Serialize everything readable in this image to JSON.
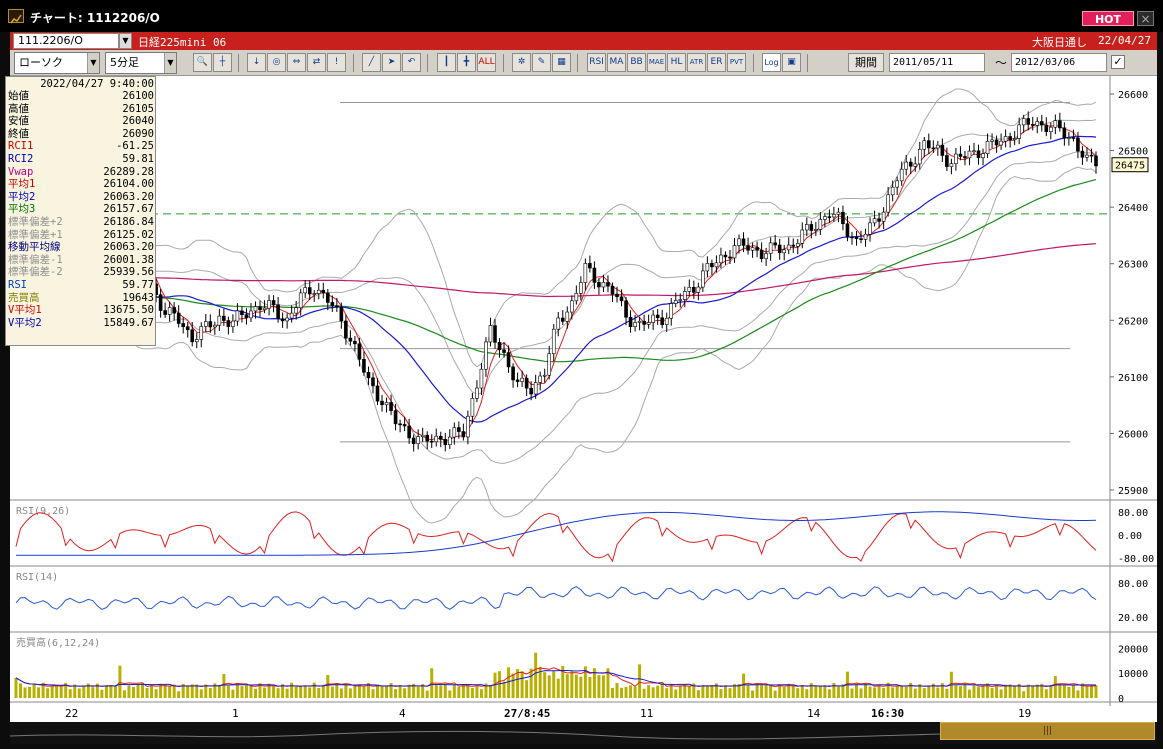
{
  "window": {
    "title": "チャート: 1112206/O",
    "hot_label": "HOT",
    "close_label": "×"
  },
  "row1": {
    "symbol_value": "111.2206/O",
    "symbol_name": "日経225mini 06",
    "feed_label": "大阪日通し",
    "feed_date": "22/04/27"
  },
  "row2": {
    "chart_type": "ローソク",
    "interval": "5分足",
    "period_label": "期間",
    "date_from": "2011/05/11",
    "date_to": "2012/03/06",
    "tilde": "〜",
    "buttons": [
      "RSI",
      "MA",
      "BB",
      "MAE",
      "HL",
      "ATR",
      "ER",
      "PVT",
      "Log"
    ]
  },
  "info": {
    "datetime": "2022/04/27  9:40:00",
    "rows": [
      {
        "label": "始値",
        "value": "26100",
        "color": "#000000"
      },
      {
        "label": "高値",
        "value": "26105",
        "color": "#000000"
      },
      {
        "label": "安値",
        "value": "26040",
        "color": "#000000"
      },
      {
        "label": "終値",
        "value": "26090",
        "color": "#000000"
      },
      {
        "label": "RCI1",
        "value": "-61.25",
        "color": "#d00000"
      },
      {
        "label": "RCI2",
        "value": "59.81",
        "color": "#0000b0"
      },
      {
        "label": "Vwap",
        "value": "26289.28",
        "color": "#c00080"
      },
      {
        "label": "平均1",
        "value": "26104.00",
        "color": "#d00000"
      },
      {
        "label": "平均2",
        "value": "26063.20",
        "color": "#0000b0"
      },
      {
        "label": "平均3",
        "value": "26157.67",
        "color": "#007000"
      },
      {
        "label": "標準偏差+2",
        "value": "26186.84",
        "color": "#909090"
      },
      {
        "label": "標準偏差+1",
        "value": "26125.02",
        "color": "#909090"
      },
      {
        "label": "移動平均線",
        "value": "26063.20",
        "color": "#000080"
      },
      {
        "label": "標準偏差-1",
        "value": "26001.38",
        "color": "#909090"
      },
      {
        "label": "標準偏差-2",
        "value": "25939.56",
        "color": "#909090"
      },
      {
        "label": "RSI",
        "value": "59.77",
        "color": "#0040c0"
      },
      {
        "label": "売買高",
        "value": "19643",
        "color": "#808000"
      },
      {
        "label": "V平均1",
        "value": "13675.50",
        "color": "#d00000"
      },
      {
        "label": "V平均2",
        "value": "15849.67",
        "color": "#0000b0"
      }
    ]
  },
  "colors": {
    "up": "#ffffff",
    "down": "#000000",
    "ma1": "#e02020",
    "ma2": "#1a1ad0",
    "ma3": "#1a8a1a",
    "vwap": "#c0186a",
    "band": "#aaaaaa",
    "dashed": "#2a9a2a",
    "rci1": "#e02020",
    "rci2": "#1a3ad0",
    "rsi": "#2a5ad8",
    "volume": "#b8b000",
    "hot": "#e3205a",
    "toolbar_red": "#c8201c"
  },
  "chart_data": [
    {
      "type": "candlestick",
      "panel": "price",
      "yticks": [
        "26600",
        "26500",
        "26400",
        "26300",
        "26200",
        "26100",
        "26000",
        "25900"
      ],
      "ylim": [
        25900,
        26600
      ],
      "current_price": "26475",
      "dashed_level": 26388,
      "hlines": [
        26585,
        26150,
        25985
      ],
      "xticks": [
        "22",
        "1",
        "4",
        "27/8:45",
        "11",
        "14",
        "16:30",
        "19"
      ],
      "series_close": [
        26230,
        26250,
        26225,
        26205,
        26180,
        26240,
        26260,
        26270,
        26230,
        26295,
        26260,
        26215,
        26200,
        26170,
        26185,
        26205,
        26195,
        26215,
        26225,
        26220,
        26200,
        26240,
        26260,
        26235,
        26200,
        26150,
        26090,
        26060,
        26020,
        26000,
        25985,
        25990,
        25995,
        26000,
        26090,
        26180,
        26140,
        26085,
        26080,
        26110,
        26200,
        26230,
        26290,
        26270,
        26250,
        26210,
        26190,
        26200,
        26210,
        26240,
        26260,
        26290,
        26310,
        26330,
        26330,
        26320,
        26325,
        26330,
        26350,
        26370,
        26390,
        26370,
        26340,
        26360,
        26400,
        26450,
        26480,
        26510,
        26500,
        26480,
        26490,
        26500,
        26510,
        26520,
        26540,
        26550,
        26545,
        26535,
        26520,
        26480
      ]
    },
    {
      "type": "line",
      "panel": "RSI(9,26)",
      "yticks": [
        "80.00",
        "0.00",
        "-80.00"
      ],
      "ylim": [
        -100,
        100
      ]
    },
    {
      "type": "line",
      "panel": "RSI(14)",
      "yticks": [
        "80.00",
        "20.00"
      ],
      "ylim": [
        0,
        100
      ]
    },
    {
      "type": "bar",
      "panel": "売買高(6,12,24)",
      "yticks": [
        "20000",
        "10000",
        "0"
      ],
      "ylim": [
        0,
        25000
      ]
    }
  ],
  "panels": {
    "rci_title": "RSI(9,26)",
    "rsi_title": "RSI(14)",
    "vol_title": "売買高(6,12,24)"
  }
}
